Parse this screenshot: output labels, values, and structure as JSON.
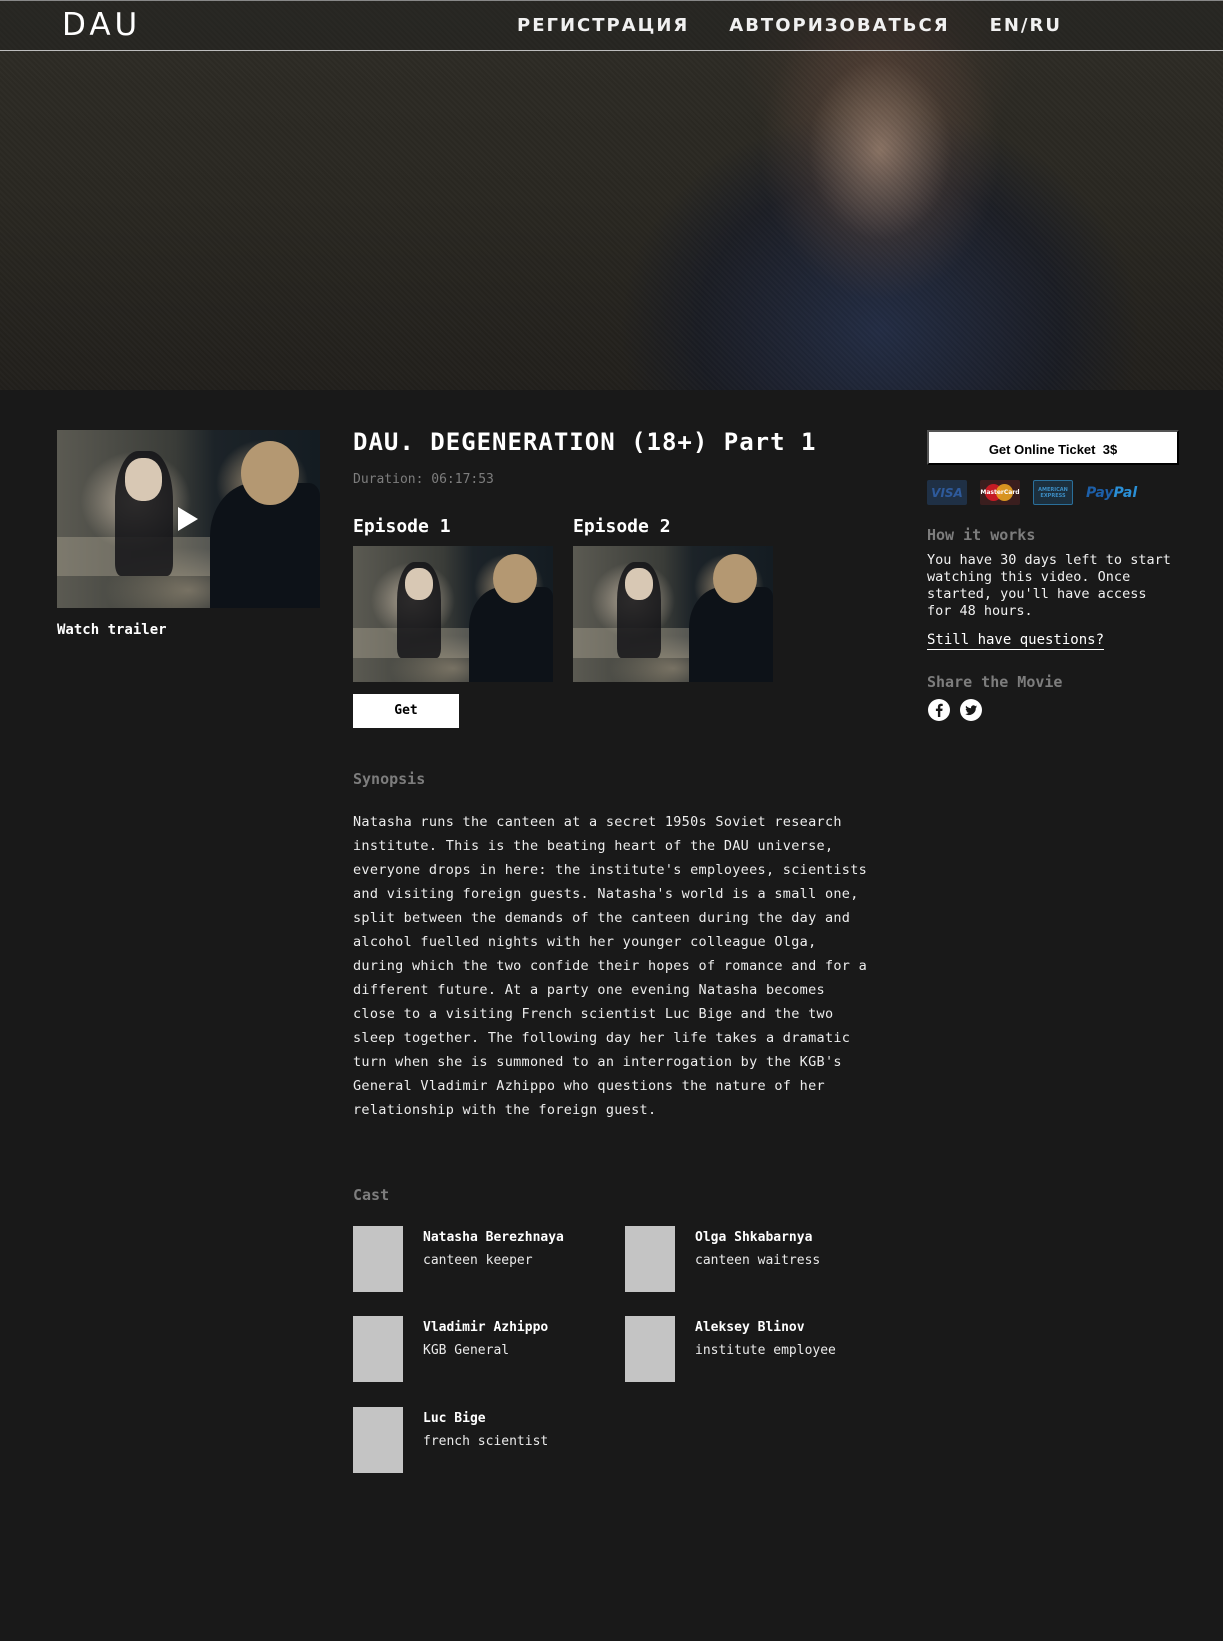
{
  "header": {
    "logo": "DAU",
    "nav": [
      "РЕГИСТРАЦИЯ",
      "АВТОРИЗОВАТЬСЯ",
      "EN/RU"
    ]
  },
  "trailer": {
    "label": "Watch trailer"
  },
  "movie": {
    "title": "DAU. DEGENERATION (18+) Part 1",
    "duration": "Duration: 06:17:53",
    "episodes": [
      {
        "label": "Episode 1"
      },
      {
        "label": "Episode 2"
      }
    ],
    "get_label": "Get"
  },
  "synopsis": {
    "heading": "Synopsis",
    "text": "Natasha runs the canteen at a secret 1950s Soviet research institute. This is the beating heart of the DAU universe, everyone drops in here: the institute's employees, scientists and visiting foreign guests. Natasha's world is a small one, split between the demands of the canteen during the day and alcohol fuelled nights with her younger colleague Olga, during which the two confide their hopes of romance and for a different future. At a party one evening Natasha becomes close to a visiting French scientist Luc Bige and the two sleep together. The following day her life takes a dramatic turn when she is summoned to an interrogation by the KGB's General Vladimir Azhippo who questions the nature of her relationship with the foreign guest."
  },
  "cast": {
    "heading": "Cast",
    "members": [
      {
        "name": "Natasha Berezhnaya",
        "role": "canteen keeper"
      },
      {
        "name": "Olga Shkabarnya",
        "role": "canteen waitress"
      },
      {
        "name": "Vladimir Azhippo",
        "role": "KGB General"
      },
      {
        "name": "Aleksey Blinov",
        "role": "institute employee"
      },
      {
        "name": "Luc Bige",
        "role": "french scientist"
      }
    ]
  },
  "sidebar": {
    "ticket_label": "Get Online Ticket  3$",
    "payments": {
      "visa": "VISA",
      "mastercard": "MasterCard",
      "amex_line1": "AMERICAN",
      "amex_line2": "EXPRESS",
      "paypal_a": "Pay",
      "paypal_b": "Pal"
    },
    "how_heading": "How it works",
    "how_text": "You have 30 days left to start watching this video. Once started, you'll have access for 48 hours.",
    "questions_label": "Still have questions?",
    "share_heading": "Share the Movie",
    "social_icons": [
      "facebook-icon",
      "twitter-icon"
    ]
  }
}
